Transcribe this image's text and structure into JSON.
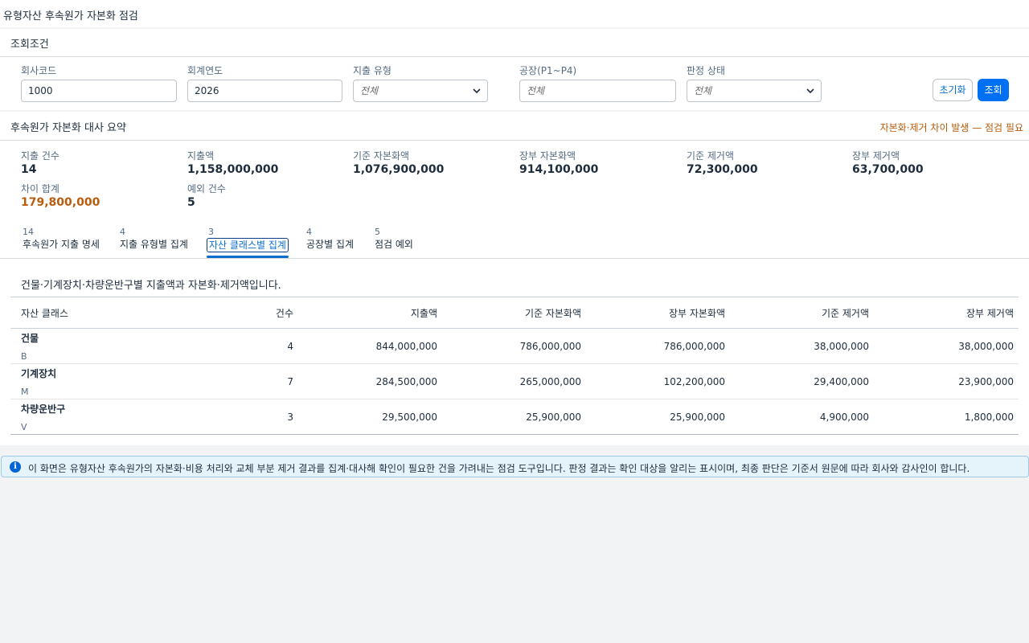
{
  "app": {
    "title": "유형자산 후속원가 자본화 점검"
  },
  "filters": {
    "section_title": "조회조건",
    "company_code": {
      "label": "회사코드",
      "value": "1000"
    },
    "fiscal_year": {
      "label": "회계연도",
      "value": "2026"
    },
    "expense_type": {
      "label": "지출 유형",
      "value": "전체"
    },
    "plant": {
      "label": "공장(P1~P4)",
      "placeholder": "전체"
    },
    "judgement_status": {
      "label": "판정 상태",
      "value": "전체"
    },
    "reset_label": "초기화",
    "search_label": "조회"
  },
  "summary": {
    "section_title": "후속원가 자본화 대사 요약",
    "warning": "자본화·제거 차이 발생 — 점검 필요",
    "kpis": [
      {
        "label": "지출 건수",
        "value": "14"
      },
      {
        "label": "지출액",
        "value": "1,158,000,000"
      },
      {
        "label": "기준 자본화액",
        "value": "1,076,900,000"
      },
      {
        "label": "장부 자본화액",
        "value": "914,100,000"
      },
      {
        "label": "기준 제거액",
        "value": "72,300,000"
      },
      {
        "label": "장부 제거액",
        "value": "63,700,000"
      },
      {
        "label": "차이 합계",
        "value": "179,800,000"
      },
      {
        "label": "예외 건수",
        "value": "5"
      }
    ]
  },
  "tabs": [
    {
      "count": "14",
      "label": "후속원가 지출 명세"
    },
    {
      "count": "4",
      "label": "지출 유형별 집계"
    },
    {
      "count": "3",
      "label": "자산 클래스별 집계"
    },
    {
      "count": "4",
      "label": "공장별 집계"
    },
    {
      "count": "5",
      "label": "점검 예외"
    }
  ],
  "content": {
    "description": "건물·기계장치·차량운반구별 지출액과 자본화·제거액입니다.",
    "columns": [
      "자산 클래스",
      "건수",
      "지출액",
      "기준 자본화액",
      "장부 자본화액",
      "기준 제거액",
      "장부 제거액"
    ],
    "rows": [
      {
        "name": "건물",
        "code": "B",
        "count": "4",
        "expense": "844,000,000",
        "std_cap": "786,000,000",
        "book_cap": "786,000,000",
        "std_ret": "38,000,000",
        "book_ret": "38,000,000"
      },
      {
        "name": "기계장치",
        "code": "M",
        "count": "7",
        "expense": "284,500,000",
        "std_cap": "265,000,000",
        "book_cap": "102,200,000",
        "std_ret": "29,400,000",
        "book_ret": "23,900,000"
      },
      {
        "name": "차량운반구",
        "code": "V",
        "count": "3",
        "expense": "29,500,000",
        "std_cap": "25,900,000",
        "book_cap": "25,900,000",
        "std_ret": "4,900,000",
        "book_ret": "1,800,000"
      }
    ]
  },
  "info": {
    "icon": "info-icon",
    "text": "이 화면은 유형자산 후속원가의 자본화·비용 처리와 교체 부분 제거 결과를 집계·대사해 확인이 필요한 건을 가려내는 점검 도구입니다. 판정 결과는 확인 대상을 알리는 표시이며, 최종 판단은 기준서 원문에 따라 회사와 감사인이 합니다."
  },
  "colors": {
    "accent": "#0a6ed1",
    "primary_button": "#0070f2",
    "warning": "#b95c0d",
    "info_bg": "#e5f3fb"
  }
}
